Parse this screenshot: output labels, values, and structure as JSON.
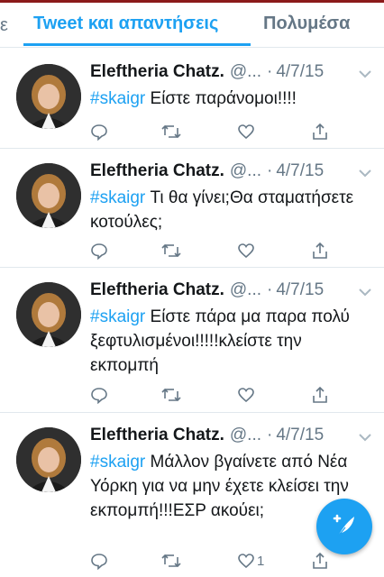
{
  "tabs": {
    "previous_fragment": "ε",
    "active": "Tweet και απαντήσεις",
    "other": "Πολυμέσα"
  },
  "colors": {
    "accent": "#1da1f2",
    "secondary_text": "#657786",
    "divider": "#e1e8ed"
  },
  "tweets": [
    {
      "name": "Eleftheria Chatz.",
      "handle": "@...",
      "dot": "·",
      "date": "4/7/15",
      "hashtag": "#skaigr",
      "text": " Είστε παράνομοι!!!!",
      "reply_count": "",
      "retweet_count": "",
      "like_count": "",
      "icons": [
        "reply-icon",
        "retweet-icon",
        "like-icon",
        "share-icon",
        "chevron-down-icon"
      ]
    },
    {
      "name": "Eleftheria Chatz.",
      "handle": "@...",
      "dot": "·",
      "date": "4/7/15",
      "hashtag": "#skaigr",
      "text": " Τι θα γίνει;Θα σταματήσετε κοτούλες;",
      "reply_count": "",
      "retweet_count": "",
      "like_count": ""
    },
    {
      "name": "Eleftheria Chatz.",
      "handle": "@...",
      "dot": "·",
      "date": "4/7/15",
      "hashtag": "#skaigr",
      "text": " Είστε πάρα μα παρα πολύ ξεφτυλισμένοι!!!!!κλείστε την εκπομπή",
      "reply_count": "",
      "retweet_count": "",
      "like_count": ""
    },
    {
      "name": "Eleftheria Chatz.",
      "handle": "@...",
      "dot": "·",
      "date": "4/7/15",
      "hashtag": "#skaigr",
      "text": " Μάλλον βγαίνετε από Νέα Υόρκη για να μην έχετε κλείσει την εκπομπή!!!ΕΣΡ ακούει;",
      "reply_count": "",
      "retweet_count": "",
      "like_count": "1"
    }
  ],
  "fab": {
    "icon": "compose-tweet-icon"
  }
}
